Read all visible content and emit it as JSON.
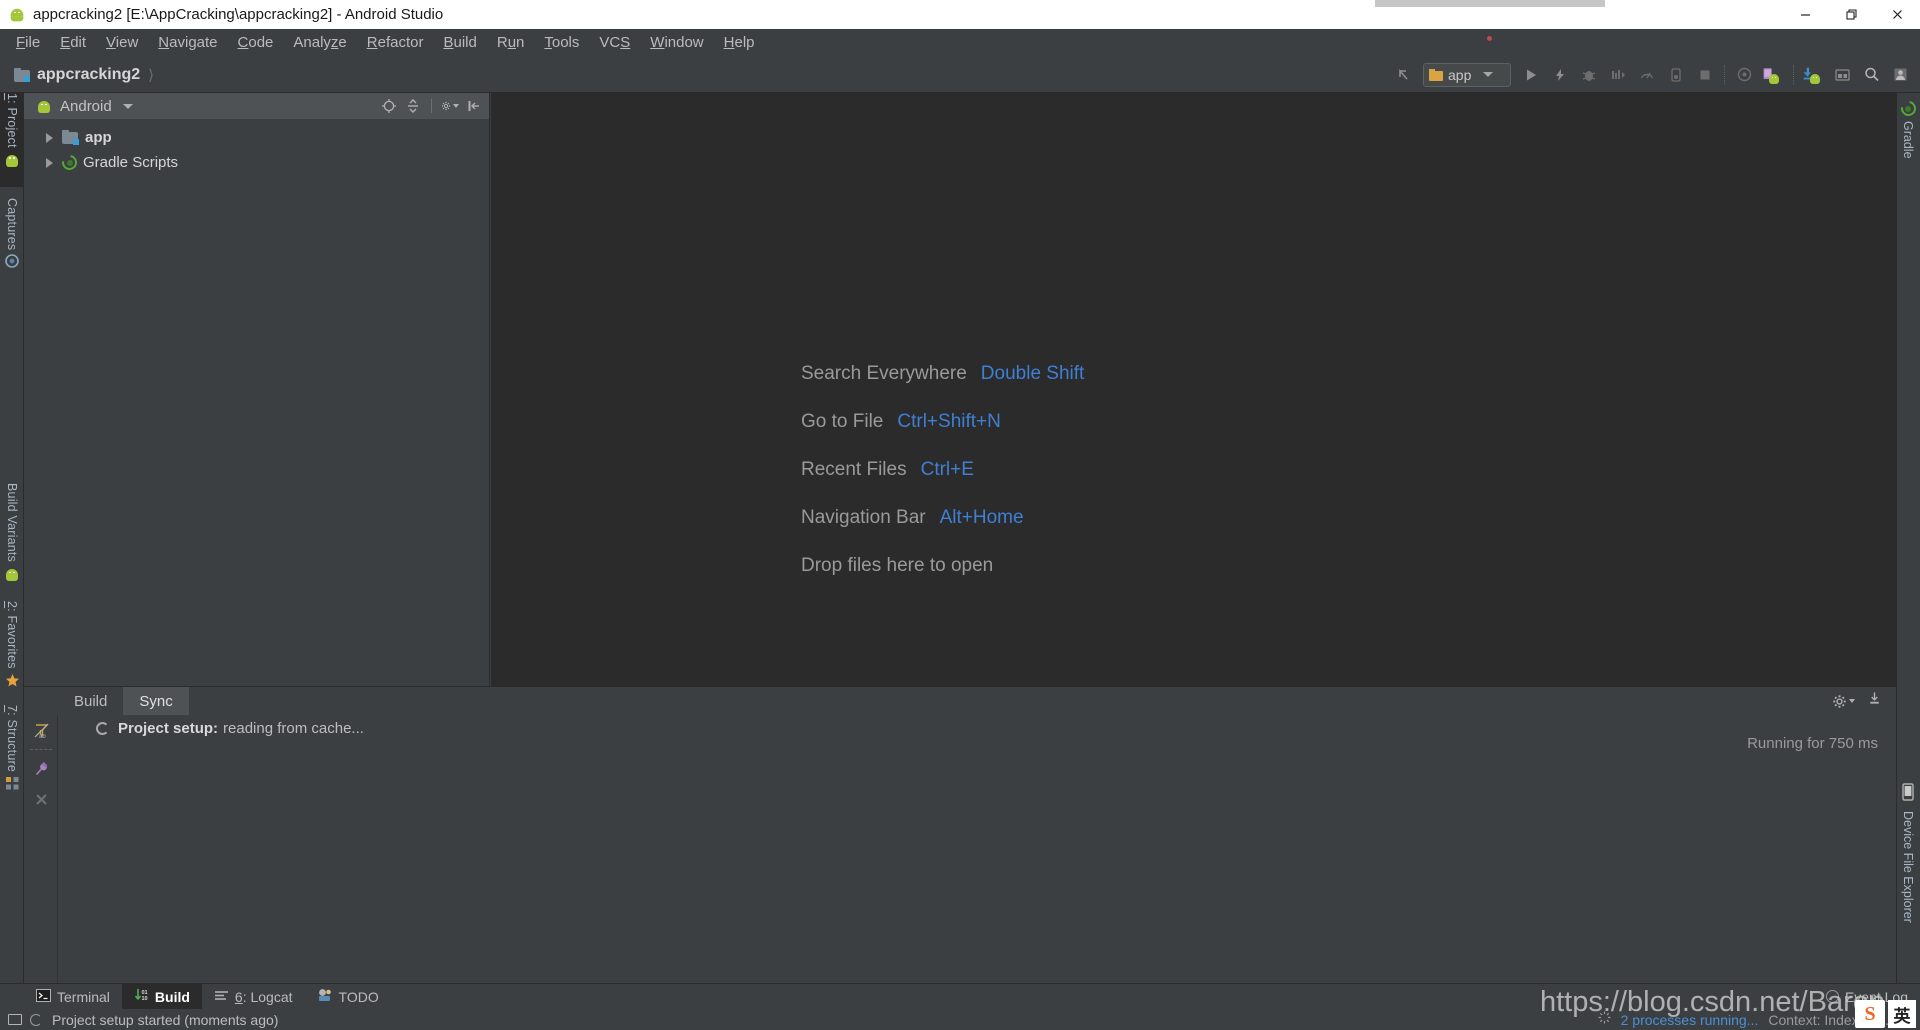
{
  "window": {
    "title": "appcracking2 [E:\\AppCracking\\appcracking2] - Android Studio",
    "app_icon": "android-studio-icon",
    "minimize_label": "—",
    "restore_label": "❐",
    "close_label": "✕"
  },
  "menubar": {
    "items": [
      {
        "label": "File",
        "mnemonic": "F"
      },
      {
        "label": "Edit",
        "mnemonic": "E"
      },
      {
        "label": "View",
        "mnemonic": "V"
      },
      {
        "label": "Navigate",
        "mnemonic": "N"
      },
      {
        "label": "Code",
        "mnemonic": "C"
      },
      {
        "label": "Analyze",
        "mnemonic": "z"
      },
      {
        "label": "Refactor",
        "mnemonic": "R"
      },
      {
        "label": "Build",
        "mnemonic": "B"
      },
      {
        "label": "Run",
        "mnemonic": "u"
      },
      {
        "label": "Tools",
        "mnemonic": "T"
      },
      {
        "label": "VCS",
        "mnemonic": "S"
      },
      {
        "label": "Window",
        "mnemonic": "W"
      },
      {
        "label": "Help",
        "mnemonic": "H"
      }
    ]
  },
  "toolbar": {
    "breadcrumb": "appcracking2",
    "run_config": "app",
    "icons": [
      "back-arrow-icon",
      "run-icon",
      "lightning-icon",
      "debug-icon",
      "profile-icon",
      "gauge-icon",
      "attach-debugger-icon",
      "stop-icon",
      "sync-gradle-icon",
      "avd-manager-icon",
      "sdk-manager-icon",
      "project-structure-icon",
      "search-icon",
      "user-icon"
    ]
  },
  "left_tool_tabs": [
    {
      "label": "1: Project",
      "mnemonic": "1",
      "icon": "android-icon",
      "active": true
    },
    {
      "label": "Captures",
      "icon": "captures-icon",
      "active": false
    },
    {
      "label": "Build Variants",
      "icon": "android-icon",
      "active": false
    },
    {
      "label": "2: Favorites",
      "mnemonic": "2",
      "icon": "star-icon",
      "active": false
    },
    {
      "label": "7: Structure",
      "mnemonic": "7",
      "icon": "structure-icon",
      "active": false
    }
  ],
  "right_tool_tabs": [
    {
      "label": "Gradle",
      "icon": "gradle-icon"
    },
    {
      "label": "Device File Explorer",
      "icon": "device-icon"
    }
  ],
  "project_panel": {
    "view_selector": "Android",
    "view_icon": "android-icon",
    "tools": [
      "locate-icon",
      "collapse-all-icon",
      "settings-gear-icon",
      "hide-panel-icon"
    ],
    "tree": [
      {
        "label": "app",
        "icon": "module-folder-icon",
        "bold": true,
        "expanded": false
      },
      {
        "label": "Gradle Scripts",
        "icon": "gradle-icon",
        "bold": false,
        "expanded": false
      }
    ]
  },
  "editor": {
    "welcome_rows": [
      {
        "action": "Search Everywhere",
        "shortcut": "Double Shift"
      },
      {
        "action": "Go to File",
        "shortcut": "Ctrl+Shift+N"
      },
      {
        "action": "Recent Files",
        "shortcut": "Ctrl+E"
      },
      {
        "action": "Navigation Bar",
        "shortcut": "Alt+Home"
      },
      {
        "action": "Drop files here to open",
        "shortcut": ""
      }
    ]
  },
  "build_window": {
    "tabs": [
      {
        "label": "Build",
        "active": false
      },
      {
        "label": "Sync",
        "active": true
      }
    ],
    "gutter_icons": [
      "filter-icon",
      "pin-icon",
      "close-icon"
    ],
    "header_icons": [
      "settings-gear-icon",
      "export-icon"
    ],
    "entry": {
      "title": "Project setup:",
      "text": "reading from cache...",
      "status_icon": "spinner-icon"
    },
    "running_text": "Running for 750 ms"
  },
  "bottom_bar": {
    "items": [
      {
        "label": "Terminal",
        "icon": "terminal-icon",
        "active": false
      },
      {
        "label": "Build",
        "icon": "build-icon",
        "active": true
      },
      {
        "label": "6: Logcat",
        "mnemonic": "6",
        "icon": "logcat-icon",
        "active": false
      },
      {
        "label": "TODO",
        "icon": "todo-icon",
        "active": false
      }
    ],
    "event_log": "Event Log",
    "event_log_icon": "event-log-icon"
  },
  "status_bar": {
    "message": "Project setup started (moments ago)",
    "processes": "2 processes running...",
    "context": "Context: Indexing...",
    "monitor_icon": "memory-monitor-icon",
    "spinner_icon": "spinner-icon"
  },
  "overlay": {
    "watermark": "https://blog.csdn.net/Baron",
    "ime_badge": "S",
    "ime_lang": "英"
  },
  "colors": {
    "accent_blue": "#3f7fd4",
    "panel_bg": "#3c3f41",
    "editor_bg": "#2b2b2b",
    "header_bg": "#4e5254",
    "android_green": "#a4c639",
    "link_blue": "#4b8fd6"
  }
}
